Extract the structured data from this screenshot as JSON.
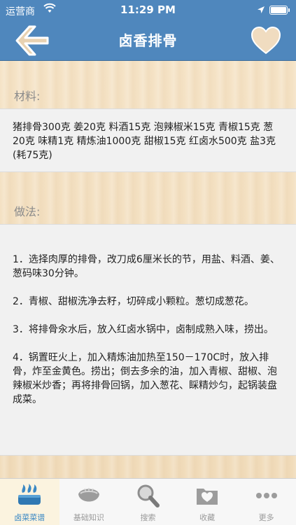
{
  "status_bar": {
    "carrier": "运营商",
    "time": "11:29 PM"
  },
  "nav": {
    "title": "卤香排骨",
    "back_icon": "back-arrow-icon",
    "favorite_icon": "heart-icon"
  },
  "ingredients": {
    "label": "材料:",
    "text": "猪排骨300克 姜20克 料酒15克 泡辣椒米15克 青椒15克 葱20克 味精1克 精炼油1000克 甜椒15克 红卤水500克 盐3克(耗75克)"
  },
  "method": {
    "label": "做法:",
    "steps": [
      "1．选择肉厚的排骨，改刀成6厘米长的节，用盐、料酒、姜、葱码味30分钟。",
      "2．青椒、甜椒洗净去籽，切碎成小颗粒。葱切成葱花。",
      "3．将排骨汆水后，放入红卤水锅中，卤制成熟入味，捞出。",
      "4．锅置旺火上，加入精炼油加热至150－170C时，放入排骨，炸至金黄色。捞出；倒去多余的油，加入青椒、甜椒、泡辣椒米炒香；再将排骨回锅，加入葱花、睬精炒匀，起锅装盘成菜。"
    ]
  },
  "tabs": [
    {
      "label": "卤菜菜谱",
      "icon": "flame-dish-icon",
      "active": true
    },
    {
      "label": "基础知识",
      "icon": "dumpling-icon",
      "active": false
    },
    {
      "label": "搜索",
      "icon": "search-icon",
      "active": false
    },
    {
      "label": "收藏",
      "icon": "folder-heart-icon",
      "active": false
    },
    {
      "label": "更多",
      "icon": "more-dots-icon",
      "active": false
    }
  ],
  "colors": {
    "nav": "#4f87bd",
    "wood": "#f3e1c4",
    "panel": "#f1f1f1",
    "tab_active": "#3a88c4"
  }
}
